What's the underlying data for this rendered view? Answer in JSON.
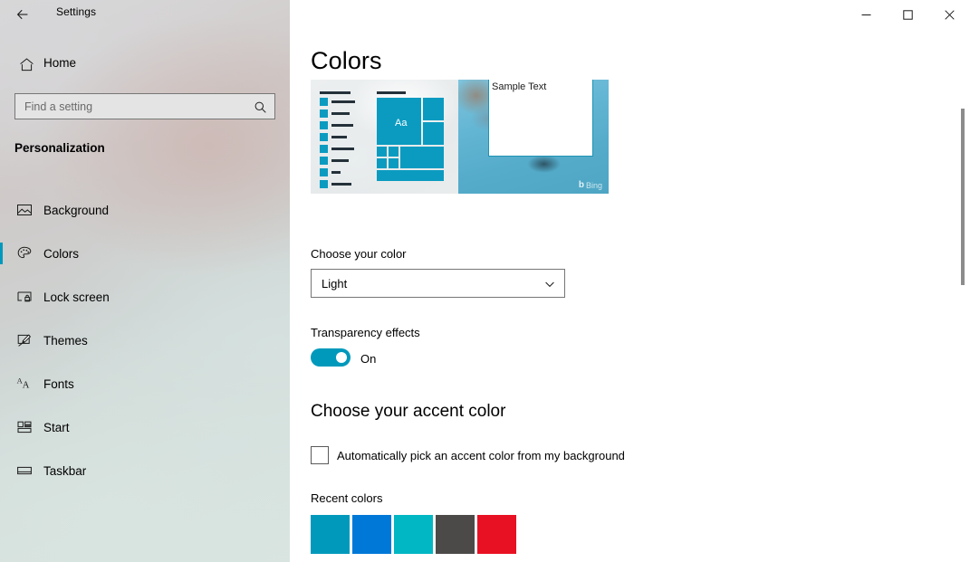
{
  "window": {
    "app_title": "Settings",
    "back_icon": "back-arrow-icon",
    "minimize_label": "─",
    "maximize_label": "☐",
    "close_label": "✕"
  },
  "sidebar": {
    "home_label": "Home",
    "home_icon": "home-icon",
    "search": {
      "placeholder": "Find a setting",
      "value": "",
      "icon": "search-icon"
    },
    "section_title": "Personalization",
    "accent_color": "#0099bc",
    "items": [
      {
        "label": "Background",
        "icon": "image-icon",
        "selected": false
      },
      {
        "label": "Colors",
        "icon": "palette-icon",
        "selected": true
      },
      {
        "label": "Lock screen",
        "icon": "lock-screen-icon",
        "selected": false
      },
      {
        "label": "Themes",
        "icon": "themes-brush-icon",
        "selected": false
      },
      {
        "label": "Fonts",
        "icon": "fonts-aa-icon",
        "selected": false
      },
      {
        "label": "Start",
        "icon": "start-tiles-icon",
        "selected": false
      },
      {
        "label": "Taskbar",
        "icon": "taskbar-icon",
        "selected": false
      }
    ]
  },
  "main": {
    "page_title": "Colors",
    "preview": {
      "tile_accent_color": "#0b9bc0",
      "tile_text": "Aa",
      "sample_window_text": "Sample Text",
      "watermark": "Bing",
      "watermark_glyph": "b"
    },
    "choose_color": {
      "label": "Choose your color",
      "selected": "Light",
      "chevron_icon": "chevron-down-icon"
    },
    "transparency": {
      "label": "Transparency effects",
      "state": "On",
      "on": true
    },
    "accent_section": {
      "heading": "Choose your accent color",
      "auto_pick_label": "Automatically pick an accent color from my background",
      "auto_pick_checked": false
    },
    "recent_colors": {
      "label": "Recent colors",
      "swatches": [
        {
          "name": "teal-blue",
          "hex": "#0099bc"
        },
        {
          "name": "blue",
          "hex": "#0078d7"
        },
        {
          "name": "cyan",
          "hex": "#00b7c3"
        },
        {
          "name": "dark-grey",
          "hex": "#4c4a48"
        },
        {
          "name": "red",
          "hex": "#e81123"
        }
      ]
    }
  }
}
